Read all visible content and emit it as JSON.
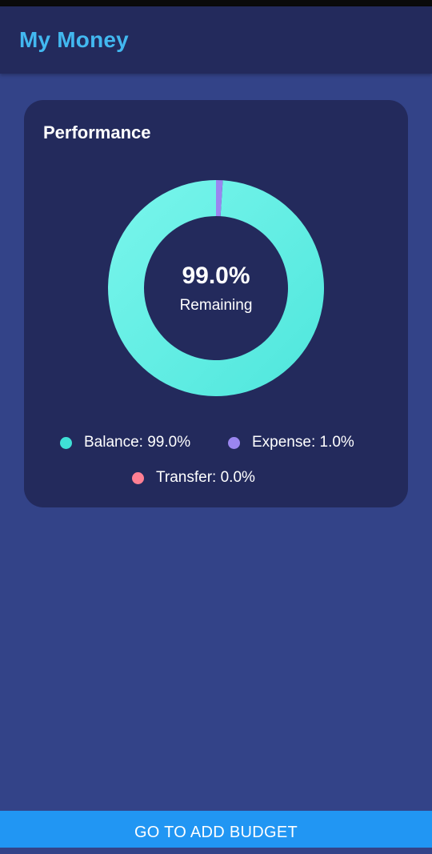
{
  "app_bar": {
    "title": "My Money"
  },
  "performance_card": {
    "title": "Performance",
    "center_value": "99.0%",
    "center_label": "Remaining",
    "legend": [
      {
        "label": "Balance: 99.0%",
        "color": "#3fe0d6"
      },
      {
        "label": "Expense: 1.0%",
        "color": "#9a86f0"
      },
      {
        "label": "Transfer: 0.0%",
        "color": "#ff7f93"
      }
    ]
  },
  "chart_data": {
    "type": "pie",
    "variant": "donut",
    "categories": [
      "Balance",
      "Expense",
      "Transfer"
    ],
    "values": [
      99.0,
      1.0,
      0.0
    ],
    "colors": [
      "#5eeee2",
      "#9a86f0",
      "#ff7f93"
    ],
    "center_text": "99.0%",
    "center_subtext": "Remaining",
    "legend_placement": "bottom"
  },
  "footer": {
    "button_label": "GO TO ADD BUDGET"
  }
}
